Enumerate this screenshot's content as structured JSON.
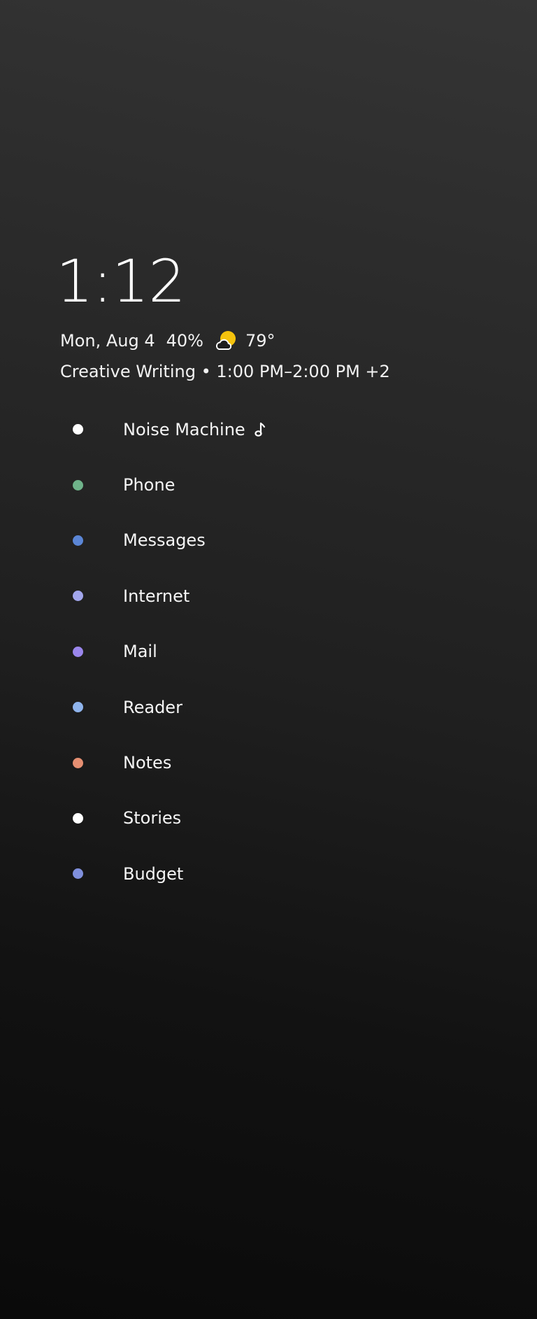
{
  "clock": {
    "time": "1:12"
  },
  "status": {
    "date": "Mon, Aug 4",
    "battery": "40%",
    "weather_icon": "partly-sunny-icon",
    "temperature": "79°"
  },
  "agenda": {
    "text": "Creative Writing • 1:00 PM–2:00 PM +2"
  },
  "apps": [
    {
      "label": "Noise Machine",
      "dot_color": "#ffffff",
      "badge_icon": "music-note-icon"
    },
    {
      "label": "Phone",
      "dot_color": "#6fb38a"
    },
    {
      "label": "Messages",
      "dot_color": "#5b86d6"
    },
    {
      "label": "Internet",
      "dot_color": "#a2a6ec"
    },
    {
      "label": "Mail",
      "dot_color": "#9a86ec"
    },
    {
      "label": "Reader",
      "dot_color": "#8fb4ec"
    },
    {
      "label": "Notes",
      "dot_color": "#e58f72"
    },
    {
      "label": "Stories",
      "dot_color": "#ffffff"
    },
    {
      "label": "Budget",
      "dot_color": "#7f8fdc"
    }
  ]
}
